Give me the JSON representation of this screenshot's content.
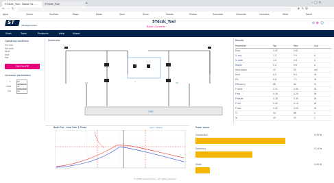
{
  "browser": {
    "tabs": [
      {
        "label": "STdcdc_Tool - Boost Ca..."
      },
      {
        "label": "STdcdc_Tool"
      }
    ],
    "bookmarks": [
      "Apps",
      "Gmail",
      "YouTube",
      "Maps",
      "News",
      "Docs",
      "Drive",
      "Sheets",
      "Photos",
      "Translate",
      "Calendar",
      "Contacts",
      "Meet",
      "Earth"
    ]
  },
  "app": {
    "logo": "ST",
    "logo_tagline": "life.augmented",
    "title": "STdcdc_Tool",
    "subtitle": "Boost Converter"
  },
  "nav": {
    "items": [
      "Start",
      "Tools",
      "Products",
      "Help",
      "About"
    ]
  },
  "left": {
    "section_title": "Operating conditions",
    "params": [
      "Vin min",
      "Vin max",
      "Vout",
      "Iout",
      "fsw"
    ],
    "button": "CALCULATE",
    "section2_title": "Converter parameters",
    "fields": [
      {
        "label": "L",
        "value": "22"
      },
      {
        "label": "Cout",
        "value": "47"
      },
      {
        "label": "Cin",
        "value": "10"
      }
    ]
  },
  "schematic": {
    "title": "Schematic",
    "bottom_label": "GND"
  },
  "results": {
    "title": "Results",
    "headers": [
      "Parameter",
      "Typ",
      "Max",
      "Unit"
    ],
    "rows": [
      [
        "Duty",
        "0.42",
        "0.61",
        "-"
      ],
      [
        "IL avg",
        "1.2",
        "1.9",
        "A"
      ],
      [
        "IL peak",
        "1.6",
        "2.4",
        "A"
      ],
      [
        "Ripple",
        "0.4",
        "0.6",
        "A"
      ],
      [
        "Vout ripple",
        "12",
        "20",
        "mV"
      ],
      [
        "Pout",
        "6.0",
        "6.0",
        "W"
      ],
      [
        "Pin",
        "6.8",
        "7.1",
        "W"
      ],
      [
        "Efficiency",
        "88",
        "84",
        "%"
      ],
      [
        "P cond",
        "0.21",
        "0.35",
        "W"
      ],
      [
        "P sw",
        "0.18",
        "0.24",
        "W"
      ],
      [
        "P diode",
        "0.28",
        "0.30",
        "W"
      ],
      [
        "P ind",
        "0.09",
        "0.14",
        "W"
      ],
      [
        "P cap",
        "0.02",
        "0.04",
        "W"
      ],
      [
        "Tj",
        "54",
        "68",
        "C"
      ],
      [
        "Ta",
        "25",
        "25",
        "C"
      ]
    ]
  },
  "bode": {
    "title": "Bode Plot - Loop Gain & Phase",
    "legend": "Gain / Phase"
  },
  "losses": {
    "title": "Power losses",
    "bars": [
      {
        "label": "Conduction",
        "fraction": 0.87
      },
      {
        "label": "Switching",
        "fraction": 0.55
      },
      {
        "label": "Diode",
        "fraction": 0.14
      }
    ],
    "values": [
      "0.35 W",
      "0.24 W",
      "0.06 W"
    ]
  },
  "footer": "© STMicroelectronics - All rights reserved"
}
